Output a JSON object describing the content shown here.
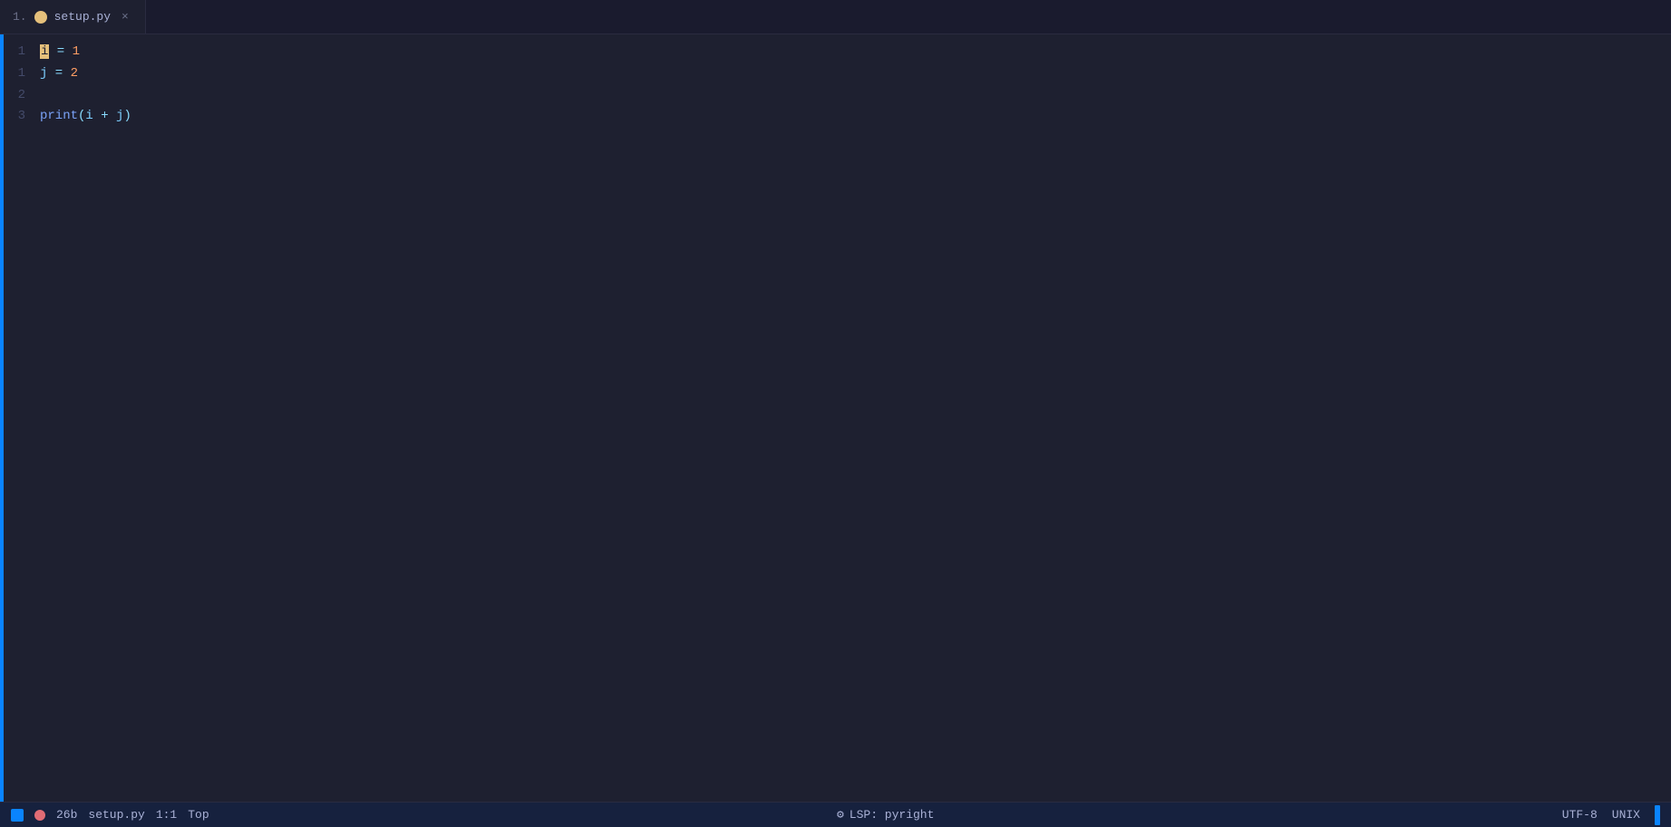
{
  "tab": {
    "number": "1.",
    "icon_color": "#e5c07b",
    "name": "setup.py",
    "close_label": "×"
  },
  "code": {
    "lines": [
      {
        "number": "1",
        "tokens": [
          {
            "type": "var-highlighted",
            "text": "i"
          },
          {
            "type": "op-color",
            "text": " = "
          },
          {
            "type": "num-color",
            "text": "1"
          }
        ]
      },
      {
        "number": "1",
        "tokens": [
          {
            "type": "var-cyan",
            "text": "j"
          },
          {
            "type": "op-color",
            "text": " = "
          },
          {
            "type": "num-color",
            "text": "2"
          }
        ]
      },
      {
        "number": "2",
        "tokens": []
      },
      {
        "number": "3",
        "tokens": [
          {
            "type": "func-color",
            "text": "print"
          },
          {
            "type": "paren-color",
            "text": "("
          },
          {
            "type": "var-cyan",
            "text": "i"
          },
          {
            "type": "op-color",
            "text": " + "
          },
          {
            "type": "var-cyan",
            "text": "j"
          },
          {
            "type": "paren-color",
            "text": ")"
          }
        ]
      }
    ]
  },
  "status": {
    "file_size": "26b",
    "file_name": "setup.py",
    "position": "1:1",
    "scroll_pos": "Top",
    "lsp_label": "LSP: pyright",
    "encoding": "UTF-8",
    "line_ending": "UNIX"
  }
}
